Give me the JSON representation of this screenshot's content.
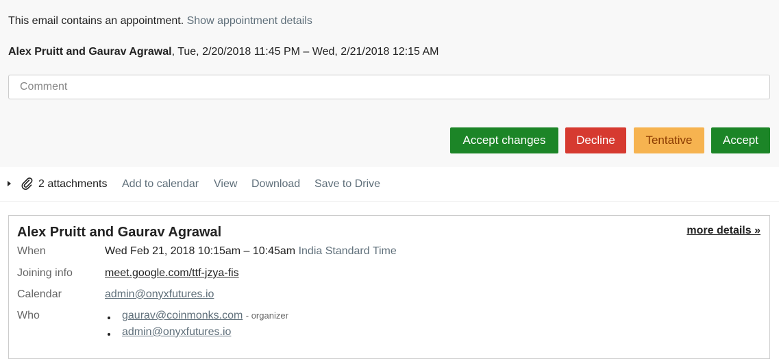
{
  "notice": {
    "text": "This email contains an appointment.",
    "link": "Show appointment details"
  },
  "summary": {
    "title": "Alex Pruitt and Gaurav Agrawal",
    "time": ", Tue, 2/20/2018 11:45 PM – Wed, 2/21/2018 12:15 AM"
  },
  "comment": {
    "placeholder": "Comment",
    "value": ""
  },
  "actions": {
    "accept_changes": "Accept changes",
    "decline": "Decline",
    "tentative": "Tentative",
    "accept": "Accept"
  },
  "attachments": {
    "count_label": "2 attachments",
    "links": [
      "Add to calendar",
      "View",
      "Download",
      "Save to Drive"
    ]
  },
  "event": {
    "title": "Alex Pruitt and Gaurav Agrawal",
    "more_details": "more details »",
    "when_label": "When",
    "when_value": "Wed Feb 21, 2018 10:15am – 10:45am",
    "timezone": "India Standard Time",
    "joining_label": "Joining info",
    "joining_value": "meet.google.com/ttf-jzya-fis",
    "calendar_label": "Calendar",
    "calendar_value": "admin@onyxfutures.io",
    "who_label": "Who",
    "who": [
      {
        "email": "gaurav@coinmonks.com",
        "role": "- organizer"
      },
      {
        "email": "admin@onyxfutures.io",
        "role": ""
      }
    ]
  },
  "colors": {
    "accept_green": "#1c8527",
    "decline_red": "#d63a30",
    "tentative_orange": "#f6b350",
    "muted_link": "#5f6f7a"
  },
  "icons": {
    "attachment": "paperclip-icon",
    "expand": "triangle-right-icon"
  }
}
